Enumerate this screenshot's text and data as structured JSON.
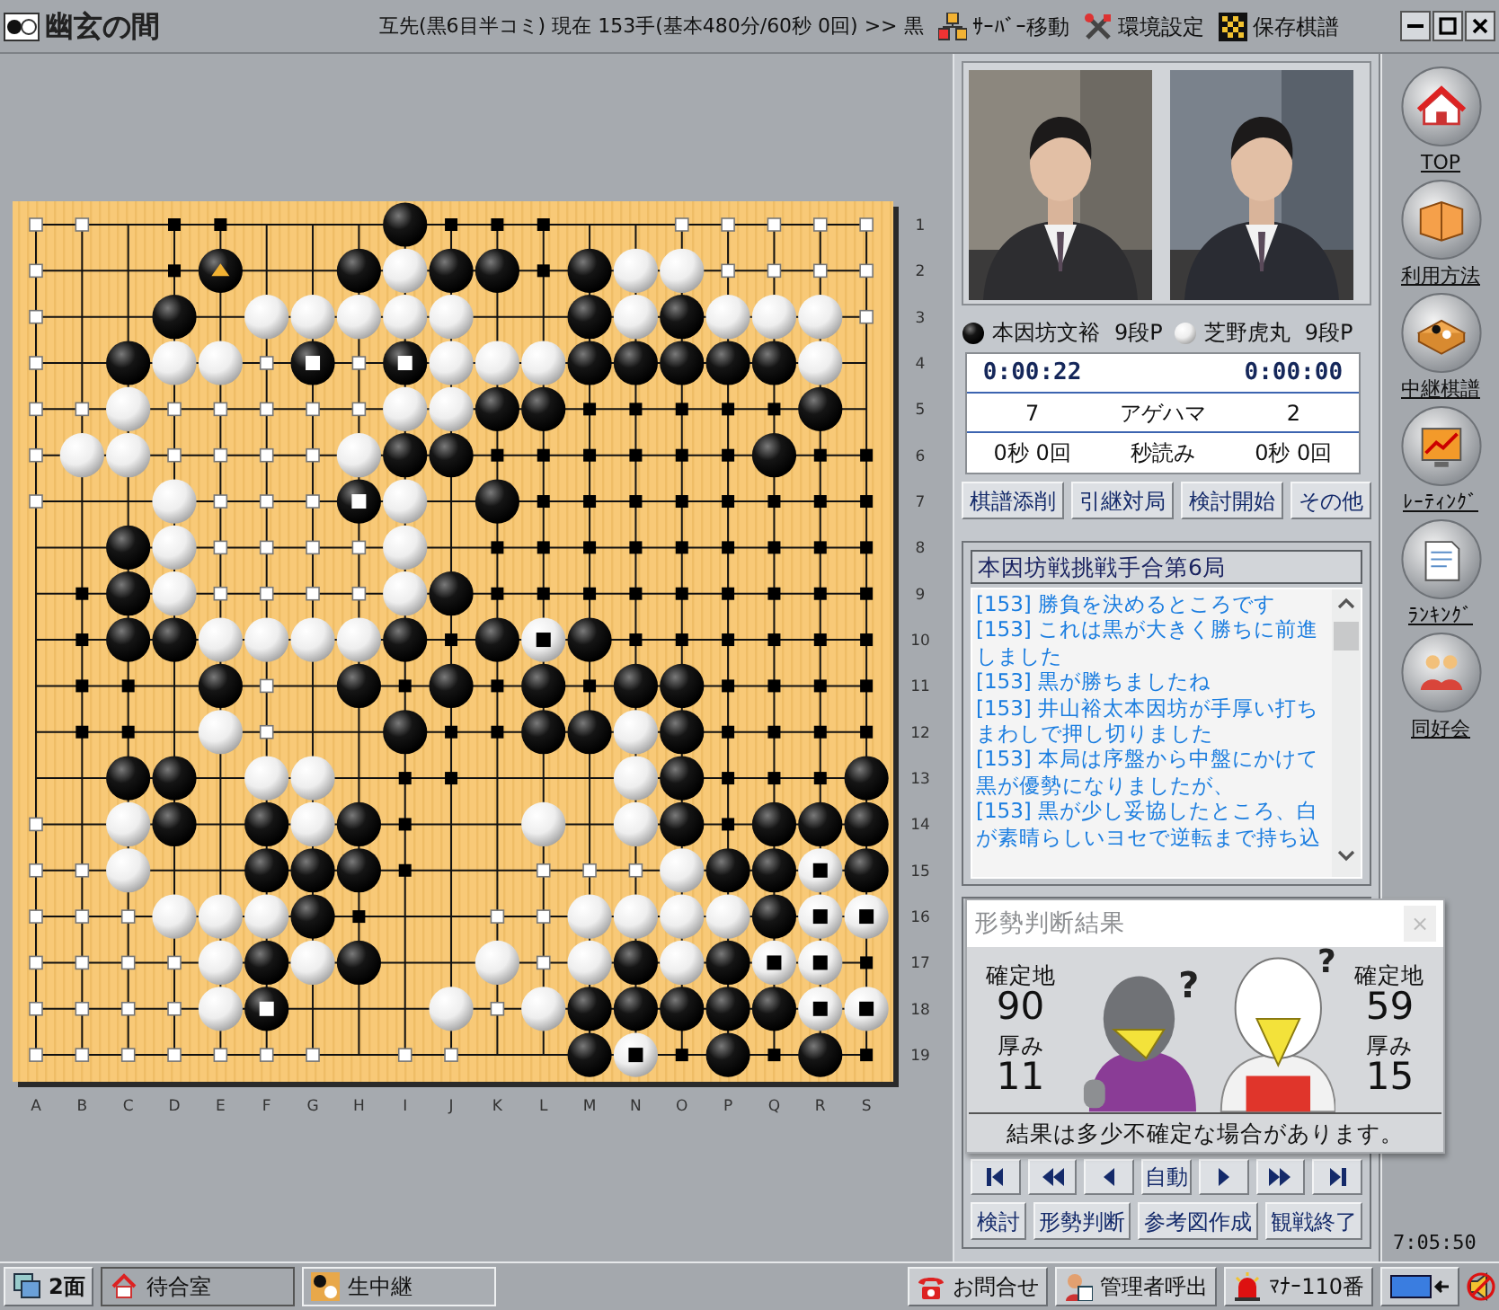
{
  "title_bar": {
    "app_name": "幽玄の間",
    "game_info": "互先(黒6目半コミ) 現在 153手(基本480分/60秒 0回) >> 黒",
    "menu": [
      {
        "label": "ｻｰﾊﾞｰ移動",
        "kind": "server"
      },
      {
        "label": "環境設定",
        "kind": "settings"
      },
      {
        "label": "保存棋譜",
        "kind": "saved"
      }
    ]
  },
  "board": {
    "rows": [
      [
        {
          "kind": "areaw"
        },
        {
          "kind": "areaw"
        },
        {
          "kind": "empty"
        },
        {
          "kind": "areab"
        },
        {
          "kind": "areab"
        },
        {
          "kind": "empty"
        },
        {
          "kind": "empty"
        },
        {
          "kind": "empty"
        },
        {
          "kind": "black"
        },
        {
          "kind": "areab"
        },
        {
          "kind": "areab"
        },
        {
          "kind": "areab"
        },
        {
          "kind": "empty"
        },
        {
          "kind": "empty"
        },
        {
          "kind": "areaw"
        },
        {
          "kind": "areaw"
        },
        {
          "kind": "areaw"
        },
        {
          "kind": "areaw"
        },
        {
          "kind": "areaw"
        }
      ],
      [
        {
          "kind": "areaw"
        },
        {
          "kind": "empty"
        },
        {
          "kind": "empty"
        },
        {
          "kind": "areab"
        },
        {
          "kind": "last"
        },
        {
          "kind": "empty"
        },
        {
          "kind": "empty"
        },
        {
          "kind": "black"
        },
        {
          "kind": "white"
        },
        {
          "kind": "black"
        },
        {
          "kind": "black"
        },
        {
          "kind": "areab"
        },
        {
          "kind": "black"
        },
        {
          "kind": "white"
        },
        {
          "kind": "white"
        },
        {
          "kind": "areaw"
        },
        {
          "kind": "areaw"
        },
        {
          "kind": "areaw"
        },
        {
          "kind": "areaw"
        }
      ],
      [
        {
          "kind": "areaw"
        },
        {
          "kind": "empty"
        },
        {
          "kind": "empty"
        },
        {
          "kind": "black"
        },
        {
          "kind": "empty"
        },
        {
          "kind": "white"
        },
        {
          "kind": "white"
        },
        {
          "kind": "white"
        },
        {
          "kind": "white"
        },
        {
          "kind": "white"
        },
        {
          "kind": "empty"
        },
        {
          "kind": "empty"
        },
        {
          "kind": "black"
        },
        {
          "kind": "white"
        },
        {
          "kind": "black"
        },
        {
          "kind": "white"
        },
        {
          "kind": "white"
        },
        {
          "kind": "white"
        },
        {
          "kind": "areaw"
        }
      ],
      [
        {
          "kind": "areaw"
        },
        {
          "kind": "empty"
        },
        {
          "kind": "black"
        },
        {
          "kind": "white"
        },
        {
          "kind": "white"
        },
        {
          "kind": "areaw"
        },
        {
          "kind": "deadb"
        },
        {
          "kind": "areaw"
        },
        {
          "kind": "deadb"
        },
        {
          "kind": "white"
        },
        {
          "kind": "white"
        },
        {
          "kind": "white"
        },
        {
          "kind": "black"
        },
        {
          "kind": "black"
        },
        {
          "kind": "black"
        },
        {
          "kind": "black"
        },
        {
          "kind": "black"
        },
        {
          "kind": "white"
        },
        {
          "kind": "empty"
        }
      ],
      [
        {
          "kind": "areaw"
        },
        {
          "kind": "areaw"
        },
        {
          "kind": "white"
        },
        {
          "kind": "areaw"
        },
        {
          "kind": "areaw"
        },
        {
          "kind": "areaw"
        },
        {
          "kind": "areaw"
        },
        {
          "kind": "areaw"
        },
        {
          "kind": "white"
        },
        {
          "kind": "white"
        },
        {
          "kind": "black"
        },
        {
          "kind": "black"
        },
        {
          "kind": "areab"
        },
        {
          "kind": "areab"
        },
        {
          "kind": "areab"
        },
        {
          "kind": "areab"
        },
        {
          "kind": "areab"
        },
        {
          "kind": "black"
        },
        {
          "kind": "empty"
        }
      ],
      [
        {
          "kind": "areaw"
        },
        {
          "kind": "white"
        },
        {
          "kind": "white"
        },
        {
          "kind": "areaw"
        },
        {
          "kind": "areaw"
        },
        {
          "kind": "areaw"
        },
        {
          "kind": "areaw"
        },
        {
          "kind": "white"
        },
        {
          "kind": "black"
        },
        {
          "kind": "black"
        },
        {
          "kind": "areab"
        },
        {
          "kind": "areab"
        },
        {
          "kind": "areab"
        },
        {
          "kind": "areab"
        },
        {
          "kind": "areab"
        },
        {
          "kind": "areab"
        },
        {
          "kind": "black"
        },
        {
          "kind": "areab"
        },
        {
          "kind": "areab"
        }
      ],
      [
        {
          "kind": "areaw"
        },
        {
          "kind": "empty"
        },
        {
          "kind": "empty"
        },
        {
          "kind": "white"
        },
        {
          "kind": "areaw"
        },
        {
          "kind": "areaw"
        },
        {
          "kind": "areaw"
        },
        {
          "kind": "deadb"
        },
        {
          "kind": "white"
        },
        {
          "kind": "empty"
        },
        {
          "kind": "black"
        },
        {
          "kind": "areab"
        },
        {
          "kind": "areab"
        },
        {
          "kind": "areab"
        },
        {
          "kind": "areab"
        },
        {
          "kind": "areab"
        },
        {
          "kind": "areab"
        },
        {
          "kind": "areab"
        },
        {
          "kind": "areab"
        }
      ],
      [
        {
          "kind": "empty"
        },
        {
          "kind": "empty"
        },
        {
          "kind": "black"
        },
        {
          "kind": "white"
        },
        {
          "kind": "areaw"
        },
        {
          "kind": "areaw"
        },
        {
          "kind": "areaw"
        },
        {
          "kind": "areaw"
        },
        {
          "kind": "white"
        },
        {
          "kind": "empty"
        },
        {
          "kind": "areab"
        },
        {
          "kind": "areab"
        },
        {
          "kind": "areab"
        },
        {
          "kind": "areab"
        },
        {
          "kind": "areab"
        },
        {
          "kind": "areab"
        },
        {
          "kind": "areab"
        },
        {
          "kind": "areab"
        },
        {
          "kind": "areab"
        }
      ],
      [
        {
          "kind": "empty"
        },
        {
          "kind": "areab"
        },
        {
          "kind": "black"
        },
        {
          "kind": "white"
        },
        {
          "kind": "areaw"
        },
        {
          "kind": "areaw"
        },
        {
          "kind": "areaw"
        },
        {
          "kind": "areaw"
        },
        {
          "kind": "white"
        },
        {
          "kind": "black"
        },
        {
          "kind": "areab"
        },
        {
          "kind": "areab"
        },
        {
          "kind": "areab"
        },
        {
          "kind": "areab"
        },
        {
          "kind": "areab"
        },
        {
          "kind": "areab"
        },
        {
          "kind": "areab"
        },
        {
          "kind": "areab"
        },
        {
          "kind": "areab"
        }
      ],
      [
        {
          "kind": "empty"
        },
        {
          "kind": "areab"
        },
        {
          "kind": "black"
        },
        {
          "kind": "black"
        },
        {
          "kind": "white"
        },
        {
          "kind": "white"
        },
        {
          "kind": "white"
        },
        {
          "kind": "white"
        },
        {
          "kind": "black"
        },
        {
          "kind": "areab"
        },
        {
          "kind": "black"
        },
        {
          "kind": "deadw"
        },
        {
          "kind": "black"
        },
        {
          "kind": "areab"
        },
        {
          "kind": "areab"
        },
        {
          "kind": "areab"
        },
        {
          "kind": "areab"
        },
        {
          "kind": "areab"
        },
        {
          "kind": "areab"
        }
      ],
      [
        {
          "kind": "empty"
        },
        {
          "kind": "areab"
        },
        {
          "kind": "areab"
        },
        {
          "kind": "empty"
        },
        {
          "kind": "black"
        },
        {
          "kind": "areaw"
        },
        {
          "kind": "empty"
        },
        {
          "kind": "black"
        },
        {
          "kind": "areab"
        },
        {
          "kind": "black"
        },
        {
          "kind": "areab"
        },
        {
          "kind": "black"
        },
        {
          "kind": "areab"
        },
        {
          "kind": "black"
        },
        {
          "kind": "black"
        },
        {
          "kind": "areab"
        },
        {
          "kind": "areab"
        },
        {
          "kind": "areab"
        },
        {
          "kind": "areab"
        }
      ],
      [
        {
          "kind": "empty"
        },
        {
          "kind": "areab"
        },
        {
          "kind": "areab"
        },
        {
          "kind": "empty"
        },
        {
          "kind": "white"
        },
        {
          "kind": "areaw"
        },
        {
          "kind": "empty"
        },
        {
          "kind": "empty"
        },
        {
          "kind": "black"
        },
        {
          "kind": "areab"
        },
        {
          "kind": "areab"
        },
        {
          "kind": "black"
        },
        {
          "kind": "black"
        },
        {
          "kind": "white"
        },
        {
          "kind": "black"
        },
        {
          "kind": "areab"
        },
        {
          "kind": "areab"
        },
        {
          "kind": "areab"
        },
        {
          "kind": "areab"
        }
      ],
      [
        {
          "kind": "empty"
        },
        {
          "kind": "empty"
        },
        {
          "kind": "black"
        },
        {
          "kind": "black"
        },
        {
          "kind": "empty"
        },
        {
          "kind": "white"
        },
        {
          "kind": "white"
        },
        {
          "kind": "empty"
        },
        {
          "kind": "areab"
        },
        {
          "kind": "areab"
        },
        {
          "kind": "empty"
        },
        {
          "kind": "empty"
        },
        {
          "kind": "empty"
        },
        {
          "kind": "white"
        },
        {
          "kind": "black"
        },
        {
          "kind": "areab"
        },
        {
          "kind": "areab"
        },
        {
          "kind": "areab"
        },
        {
          "kind": "black"
        }
      ],
      [
        {
          "kind": "areaw"
        },
        {
          "kind": "empty"
        },
        {
          "kind": "white"
        },
        {
          "kind": "black"
        },
        {
          "kind": "empty"
        },
        {
          "kind": "black"
        },
        {
          "kind": "white"
        },
        {
          "kind": "black"
        },
        {
          "kind": "areab"
        },
        {
          "kind": "empty"
        },
        {
          "kind": "empty"
        },
        {
          "kind": "white"
        },
        {
          "kind": "empty"
        },
        {
          "kind": "white"
        },
        {
          "kind": "black"
        },
        {
          "kind": "areab"
        },
        {
          "kind": "black"
        },
        {
          "kind": "black"
        },
        {
          "kind": "black"
        }
      ],
      [
        {
          "kind": "areaw"
        },
        {
          "kind": "areaw"
        },
        {
          "kind": "white"
        },
        {
          "kind": "empty"
        },
        {
          "kind": "empty"
        },
        {
          "kind": "black"
        },
        {
          "kind": "black"
        },
        {
          "kind": "black"
        },
        {
          "kind": "areab"
        },
        {
          "kind": "empty"
        },
        {
          "kind": "empty"
        },
        {
          "kind": "areaw"
        },
        {
          "kind": "areaw"
        },
        {
          "kind": "areaw"
        },
        {
          "kind": "white"
        },
        {
          "kind": "black"
        },
        {
          "kind": "black"
        },
        {
          "kind": "deadw"
        },
        {
          "kind": "black"
        }
      ],
      [
        {
          "kind": "areaw"
        },
        {
          "kind": "areaw"
        },
        {
          "kind": "areaw"
        },
        {
          "kind": "white"
        },
        {
          "kind": "white"
        },
        {
          "kind": "white"
        },
        {
          "kind": "black"
        },
        {
          "kind": "areab"
        },
        {
          "kind": "empty"
        },
        {
          "kind": "empty"
        },
        {
          "kind": "areaw"
        },
        {
          "kind": "areaw"
        },
        {
          "kind": "white"
        },
        {
          "kind": "white"
        },
        {
          "kind": "white"
        },
        {
          "kind": "white"
        },
        {
          "kind": "black"
        },
        {
          "kind": "deadw"
        },
        {
          "kind": "deadw"
        }
      ],
      [
        {
          "kind": "areaw"
        },
        {
          "kind": "areaw"
        },
        {
          "kind": "areaw"
        },
        {
          "kind": "areaw"
        },
        {
          "kind": "white"
        },
        {
          "kind": "black"
        },
        {
          "kind": "white"
        },
        {
          "kind": "black"
        },
        {
          "kind": "empty"
        },
        {
          "kind": "empty"
        },
        {
          "kind": "white"
        },
        {
          "kind": "areaw"
        },
        {
          "kind": "white"
        },
        {
          "kind": "black"
        },
        {
          "kind": "white"
        },
        {
          "kind": "black"
        },
        {
          "kind": "deadw"
        },
        {
          "kind": "deadw"
        },
        {
          "kind": "areab"
        }
      ],
      [
        {
          "kind": "areaw"
        },
        {
          "kind": "areaw"
        },
        {
          "kind": "areaw"
        },
        {
          "kind": "areaw"
        },
        {
          "kind": "white"
        },
        {
          "kind": "deadb"
        },
        {
          "kind": "empty"
        },
        {
          "kind": "empty"
        },
        {
          "kind": "empty"
        },
        {
          "kind": "white"
        },
        {
          "kind": "areaw"
        },
        {
          "kind": "white"
        },
        {
          "kind": "black"
        },
        {
          "kind": "black"
        },
        {
          "kind": "black"
        },
        {
          "kind": "black"
        },
        {
          "kind": "black"
        },
        {
          "kind": "deadw"
        },
        {
          "kind": "deadw"
        }
      ],
      [
        {
          "kind": "areaw"
        },
        {
          "kind": "areaw"
        },
        {
          "kind": "areaw"
        },
        {
          "kind": "areaw"
        },
        {
          "kind": "areaw"
        },
        {
          "kind": "areaw"
        },
        {
          "kind": "areaw"
        },
        {
          "kind": "empty"
        },
        {
          "kind": "areaw"
        },
        {
          "kind": "areaw"
        },
        {
          "kind": "empty"
        },
        {
          "kind": "empty"
        },
        {
          "kind": "black"
        },
        {
          "kind": "deadw"
        },
        {
          "kind": "areab"
        },
        {
          "kind": "black"
        },
        {
          "kind": "areab"
        },
        {
          "kind": "black"
        },
        {
          "kind": "areab"
        }
      ]
    ],
    "column_labels": [
      "A",
      "B",
      "C",
      "D",
      "E",
      "F",
      "G",
      "H",
      "I",
      "J",
      "K",
      "L",
      "M",
      "N",
      "O",
      "P",
      "Q",
      "R",
      "S"
    ],
    "row_labels": [
      "1",
      "2",
      "3",
      "4",
      "5",
      "6",
      "7",
      "8",
      "9",
      "10",
      "11",
      "12",
      "13",
      "14",
      "15",
      "16",
      "17",
      "18",
      "19"
    ]
  },
  "players": [
    {
      "kind": "black",
      "name": "本因坊文裕",
      "rank": "9段P",
      "time": "0:00:22",
      "captures": "7",
      "byoyomi": "0秒 0回"
    },
    {
      "kind": "white",
      "name": "芝野虎丸",
      "rank": "9段P",
      "time": "0:00:00",
      "captures": "2",
      "byoyomi": "0秒 0回"
    }
  ],
  "clock_labels": {
    "captures": "アゲハマ",
    "byoyomi": "秒読み"
  },
  "game_buttons": [
    "棋譜添削",
    "引継対局",
    "検討開始",
    "その他"
  ],
  "chat": {
    "title": "本因坊戦挑戦手合第6局",
    "messages": [
      "[153] 勝負を決めるところです",
      "[153] これは黒が大きく勝ちに前進しました",
      "[153] 黒が勝ちましたね",
      "[153] 井山裕太本因坊が手厚い打ちまわしで押し切りました",
      "[153] 本局は序盤から中盤にかけて黒が優勢になりましたが、",
      "[153] 黒が少し妥協したところ、白が素晴らしいヨセで逆転まで持ち込"
    ]
  },
  "evaluation": {
    "title": "形勢判断結果",
    "close": "×",
    "question_marks": [
      "?",
      "?"
    ],
    "sides": [
      {
        "territory_label": "確定地",
        "territory": "90",
        "thickness_label": "厚み",
        "thickness": "11"
      },
      {
        "territory_label": "確定地",
        "territory": "59",
        "thickness_label": "厚み",
        "thickness": "15"
      }
    ],
    "note": "結果は多少不確定な場合があります。"
  },
  "navigation": [
    {
      "kind": "first"
    },
    {
      "kind": "back_fast"
    },
    {
      "kind": "back"
    },
    {
      "kind": "auto",
      "label": "自動"
    },
    {
      "kind": "forward"
    },
    {
      "kind": "forward_fast"
    },
    {
      "kind": "last"
    }
  ],
  "action_buttons": [
    "検討",
    "形勢判断",
    "参考図作成",
    "観戦終了"
  ],
  "clock": "7:05:50",
  "sidebar": [
    {
      "label": "TOP",
      "kind": "top"
    },
    {
      "label": "利用方法",
      "kind": "guide"
    },
    {
      "label": "中継棋譜",
      "kind": "records"
    },
    {
      "label": "ﾚｰﾃｨﾝｸﾞ",
      "kind": "rating"
    },
    {
      "label": "ﾗﾝｷﾝｸﾞ",
      "kind": "ranking"
    },
    {
      "label": "同好会",
      "kind": "club"
    }
  ],
  "taskbar": {
    "screens": "2面",
    "windows": [
      {
        "label": "待合室",
        "kind": "home",
        "selected": false
      },
      {
        "label": "生中継",
        "kind": "live",
        "selected": true
      }
    ],
    "buttons": [
      {
        "label": "お問合せ",
        "kind": "phone"
      },
      {
        "label": "管理者呼出",
        "kind": "admin"
      },
      {
        "label": "ﾏﾅｰ110番",
        "kind": "alarm"
      }
    ]
  }
}
